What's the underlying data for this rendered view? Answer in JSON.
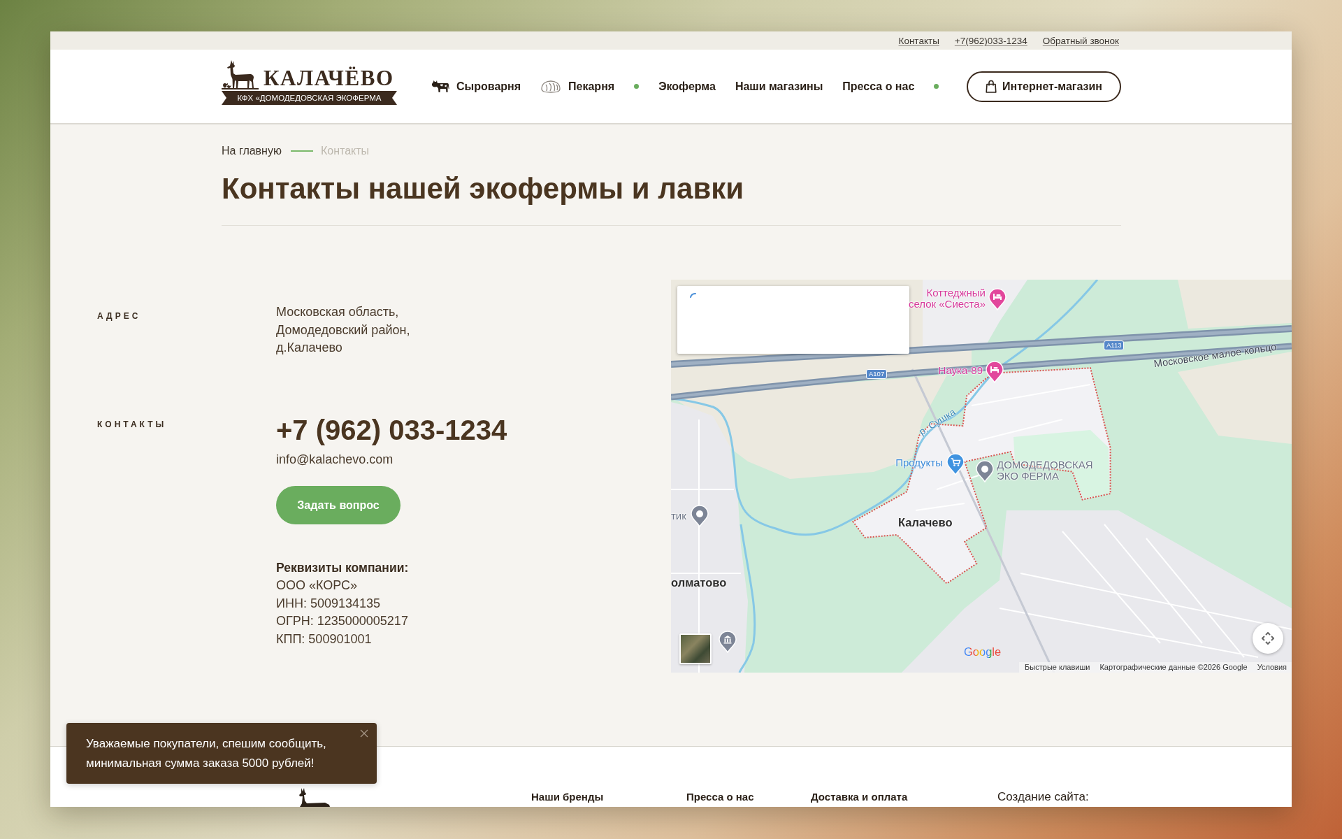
{
  "top_bar": {
    "links": [
      "Контакты",
      "+7(962)033-1234",
      "Обратный звонок"
    ]
  },
  "header": {
    "logo": {
      "title": "КАЛАЧЁВО",
      "subtitle": "КФХ «ДОМОДЕДОВСКАЯ ЭКОФЕРМА"
    },
    "nav": [
      {
        "kind": "icon",
        "label": "Сыроварня"
      },
      {
        "kind": "icon",
        "label": "Пекарня"
      },
      {
        "kind": "separator"
      },
      {
        "kind": "text",
        "label": "Экоферма"
      },
      {
        "kind": "text",
        "label": "Наши магазины"
      },
      {
        "kind": "text",
        "label": "Пресса о нас"
      },
      {
        "kind": "separator"
      }
    ],
    "shop_button": "Интернет-магазин"
  },
  "breadcrumbs": [
    {
      "label": "На главную",
      "current": false
    },
    {
      "label": "Контакты",
      "current": true
    }
  ],
  "title": "Контакты нашей экофермы и лавки",
  "address": {
    "label": "АДРЕС",
    "lines": [
      "Московская область,",
      "Домодедовский район,",
      "д.Калачево"
    ]
  },
  "contacts": {
    "label": "КОНТАКТЫ",
    "phone": "+7 (962) 033-1234",
    "email": "info@kalachevo.com",
    "button": "Задать вопрос",
    "requisites": {
      "heading": "Реквизиты компании:",
      "lines": [
        "ООО «КОРС»",
        "ИНН: 5009134135",
        "ОГРН: 1235000005217",
        "КПП: 500901001"
      ]
    }
  },
  "map": {
    "info_panel": {
      "loading": true
    },
    "places": [
      {
        "kind": "hotel",
        "lines": [
          "Коттеджный",
          "селок «Сиеста»"
        ]
      },
      {
        "kind": "hotel",
        "lines": [
          "Наука-89"
        ]
      },
      {
        "kind": "shop",
        "lines": [
          "Продукты"
        ]
      },
      {
        "kind": "place",
        "lines": [
          "ДОМОДЕДОВСКАЯ",
          "ЭКО ФЕРМА"
        ]
      },
      {
        "kind": "place",
        "lines": [
          "тик"
        ]
      },
      {
        "kind": "museum"
      }
    ],
    "towns": [
      "Калачево",
      "олматово"
    ],
    "road_signs": [
      "А113",
      "А107"
    ],
    "road_name": "Московское малое кольцо",
    "river": "р. Сушка",
    "logo": "Google",
    "attribution": [
      "Быстрые клавиши",
      "Картографические данные ©2026 Google",
      "Условия"
    ]
  },
  "footer": {
    "links": [
      "Наши бренды",
      "Пресса о нас",
      "Доставка и оплата"
    ],
    "credit": "Создание сайта:"
  },
  "toast": {
    "lines": [
      "Уважаемые покупатели, спешим сообщить,",
      "минимальная сумма заказа 5000 рублей!"
    ]
  }
}
